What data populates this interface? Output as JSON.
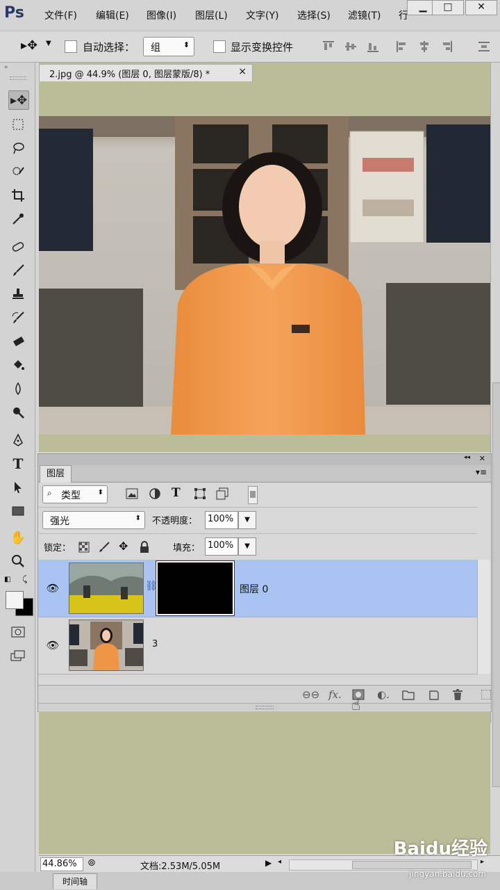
{
  "app": {
    "logo": "Ps"
  },
  "menu": [
    "文件(F)",
    "编辑(E)",
    "图像(I)",
    "图层(L)",
    "文字(Y)",
    "选择(S)",
    "滤镜(T)",
    "行"
  ],
  "window_buttons": [
    "minimize",
    "maximize",
    "close"
  ],
  "options": {
    "auto_select_label": "自动选择：",
    "auto_select_value": "组",
    "show_transform_label": "显示变换控件"
  },
  "document": {
    "tab_title": "2.jpg @ 44.9% (图层 0, 图层蒙版/8) *",
    "tab_close": "×"
  },
  "layers_panel": {
    "tab": "图层",
    "filter_kind": "类型",
    "blend_mode": "强光",
    "opacity_label": "不透明度：",
    "opacity_value": "100%",
    "lock_label": "锁定：",
    "fill_label": "填充：",
    "fill_value": "100%",
    "layers": [
      {
        "name": "图层 0",
        "selected": true,
        "visible": true,
        "has_mask": true
      },
      {
        "name": "3",
        "selected": false,
        "visible": true,
        "has_mask": false
      }
    ]
  },
  "status": {
    "zoom": "44.86%",
    "doc_info": "文档:2.53M/5.05M"
  },
  "bottom_tab": "时间轴",
  "watermark": {
    "brand": "Baidu经验",
    "url": "jingyan.baidu.com"
  },
  "colors": {
    "canvas_bg": "#bbbd98",
    "selected_layer": "#a9c4f2",
    "panel_bg": "#d8d8d8"
  }
}
